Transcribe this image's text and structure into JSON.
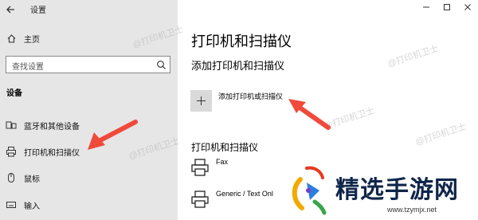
{
  "window": {
    "app_title": "设置"
  },
  "sidebar": {
    "home_label": "主页",
    "search_placeholder": "查找设置",
    "section_label": "设备",
    "items": [
      {
        "label": "蓝牙和其他设备",
        "icon": "bluetooth-devices-icon"
      },
      {
        "label": "打印机和扫描仪",
        "icon": "printer-icon"
      },
      {
        "label": "鼠标",
        "icon": "mouse-icon"
      },
      {
        "label": "输入",
        "icon": "keyboard-icon"
      }
    ]
  },
  "main": {
    "title": "打印机和扫描仪",
    "add_section_title": "添加打印机和扫描仪",
    "add_button_label": "添加打印机或扫描仪",
    "list_title": "打印机和扫描仪",
    "printers": [
      {
        "name": "Fax"
      },
      {
        "name": "Generic / Text Onl"
      }
    ]
  },
  "watermarks": [
    "@打印机卫士",
    "@打印机卫士",
    "@打印机卫士",
    "@打印机卫士",
    "@打印机卫士"
  ],
  "logo": {
    "text": "精选手游网",
    "url": "www.tzymjx.net"
  },
  "colors": {
    "sidebar_bg": "#e6e6e6",
    "annotation_arrow": "#f04a3a",
    "logo_text": "#10264a"
  }
}
